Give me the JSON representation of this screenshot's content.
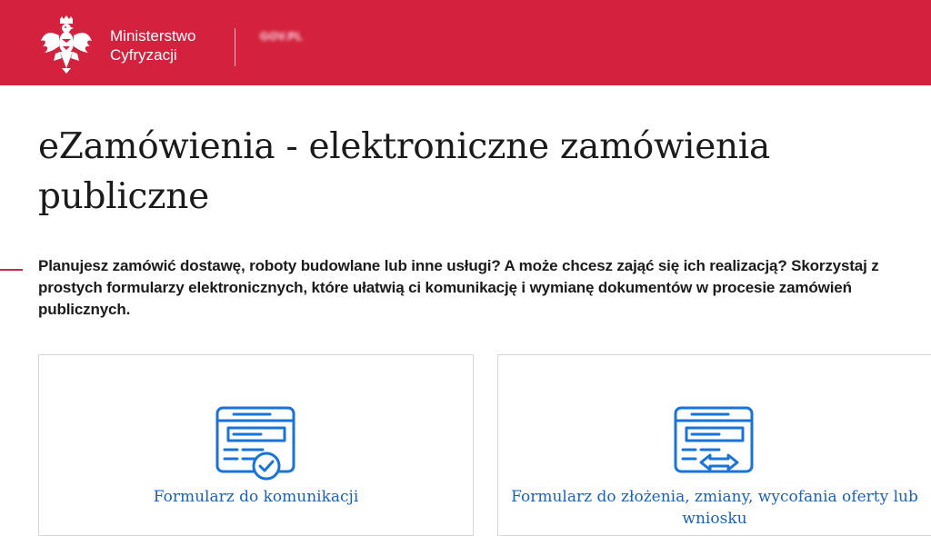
{
  "header": {
    "ministry_line1": "Ministerstwo",
    "ministry_line2": "Cyfryzacji",
    "service_name": "GOV.PL",
    "service_sub": "",
    "emblem_icon": "polish-eagle-emblem",
    "bg_color": "#d4213d"
  },
  "main": {
    "title": "eZamówienia - elektroniczne zamówienia publiczne",
    "lead": "Planujesz zamówić dostawę, roboty budowlane lub inne usługi? A może chcesz zająć się ich realizacją? Skorzystaj z prostych formularzy elektronicznych, które ułatwią ci komunikację i wymianę dokumentów w procesie zamówień publicznych.",
    "accent_color": "#d4213d"
  },
  "cards": [
    {
      "label": "Formularz do komunikacji",
      "icon": "form-check-icon"
    },
    {
      "label": "Formularz do złożenia, zmiany, wycofania oferty lub wniosku",
      "icon": "form-exchange-icon"
    }
  ],
  "colors": {
    "link": "#1a62b8",
    "icon": "#1a73d9"
  }
}
